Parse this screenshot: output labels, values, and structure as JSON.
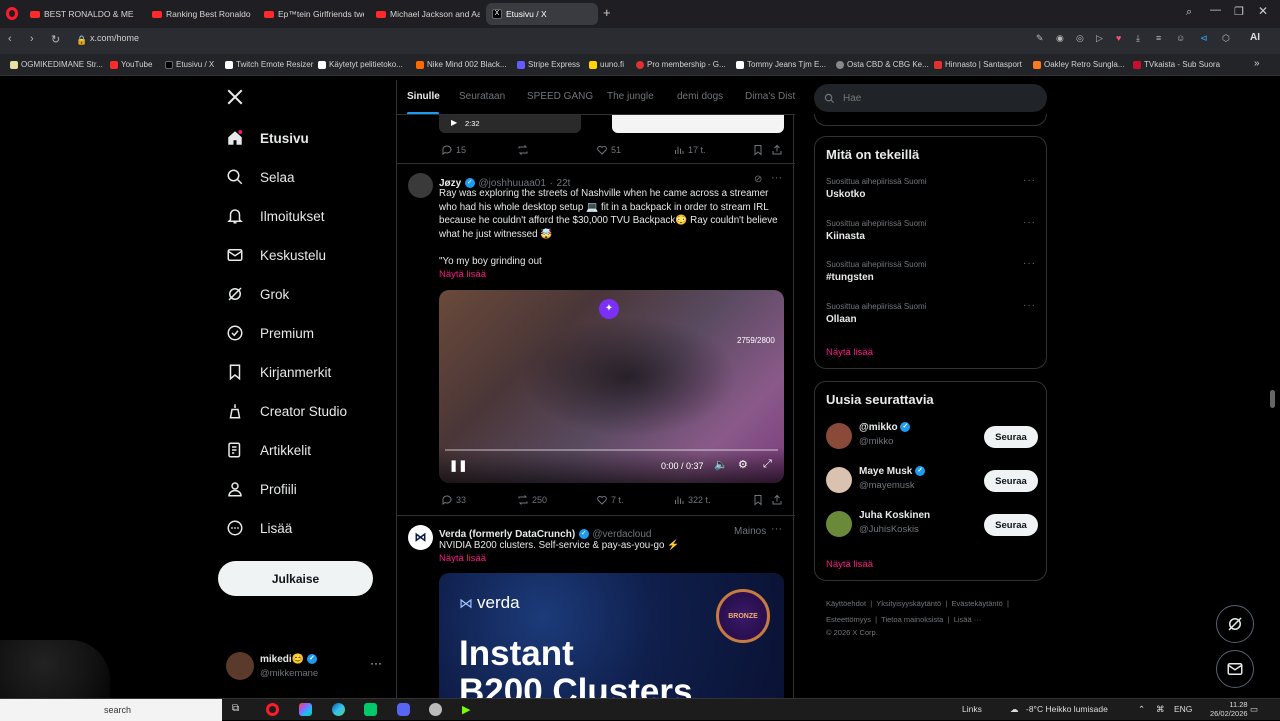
{
  "browser": {
    "tabs": [
      {
        "label": "BEST RONALDO & MESSI",
        "icon": "youtube-icon"
      },
      {
        "label": "Ranking Best Ronaldo & M",
        "icon": "youtube-icon"
      },
      {
        "label": "Ep™tein Girlfriends tweets",
        "icon": "youtube-icon"
      },
      {
        "label": "Michael Jackson and Aaro",
        "icon": "youtube-icon"
      },
      {
        "label": "Etusivu / X",
        "icon": "x-icon",
        "active": true
      }
    ],
    "address": "x.com/home",
    "ai_label": "AI",
    "bookmarks": [
      {
        "label": "OGMIKEDIMANE Str...",
        "color": "#e8e0a0"
      },
      {
        "label": "YouTube",
        "color": "#ff2a2a"
      },
      {
        "label": "Etusivu / X",
        "color": "#000000"
      },
      {
        "label": "Twitch Emote Resizer",
        "color": "#ffffff"
      },
      {
        "label": "Käytetyt pelitietoko...",
        "color": "#ffffff"
      },
      {
        "label": "Nike Mind 002 Black...",
        "color": "#ff6a00"
      },
      {
        "label": "Stripe Express",
        "color": "#635bff"
      },
      {
        "label": "uuno.fi",
        "color": "#ffd400"
      },
      {
        "label": "Pro membership - G...",
        "color": "#e03030"
      },
      {
        "label": "Tommy Jeans Tjm E...",
        "color": "#ffffff"
      },
      {
        "label": "Osta CBD & CBG Ke...",
        "color": "#888888"
      },
      {
        "label": "Hinnasto | Santasport",
        "color": "#e03030"
      },
      {
        "label": "Oakley Retro Sungla...",
        "color": "#ff7a1a"
      },
      {
        "label": "TVkaista - Sub Suora",
        "color": "#c8102e"
      }
    ]
  },
  "nav": {
    "items": [
      {
        "label": "Etusivu",
        "icon": "home-icon",
        "active": true
      },
      {
        "label": "Selaa",
        "icon": "search-icon"
      },
      {
        "label": "Ilmoitukset",
        "icon": "bell-icon"
      },
      {
        "label": "Keskustelu",
        "icon": "mail-icon"
      },
      {
        "label": "Grok",
        "icon": "grok-icon"
      },
      {
        "label": "Premium",
        "icon": "premium-icon"
      },
      {
        "label": "Kirjanmerkit",
        "icon": "bookmark-icon"
      },
      {
        "label": "Creator Studio",
        "icon": "creator-icon"
      },
      {
        "label": "Artikkelit",
        "icon": "article-icon"
      },
      {
        "label": "Profiili",
        "icon": "profile-icon"
      },
      {
        "label": "Lisää",
        "icon": "more-circle-icon"
      }
    ],
    "post_button": "Julkaise",
    "account": {
      "name": "mikedi😊",
      "handle": "@mikkemane"
    }
  },
  "feed": {
    "tabs": [
      "Sinulle",
      "Seurataan",
      "SPEED GANG",
      "The jungle",
      "demi dogs",
      "Dima's Dist"
    ],
    "prev_post": {
      "duration": "2:32",
      "replies": "15",
      "reposts": "",
      "likes": "51",
      "views": "17 t."
    },
    "post": {
      "name": "Jøzy",
      "handle": "@joshhuuaa01",
      "time": "22t",
      "text_1": "Ray was exploring the streets of Nashville when he came across a streamer who had his whole desktop setup 💻 fit in a backpack in order to stream IRL because he couldn't afford the $30,000 TVU Backpack😳 Ray couldn't believe what he just witnessed 🤯",
      "text_2": "\"Yo my boy grinding out",
      "show_more": "Näytä lisää",
      "video": {
        "overlay_count": "2759/2800",
        "time": "0:00 / 0:37"
      },
      "replies": "33",
      "reposts": "250",
      "likes": "7 t.",
      "views": "322 t."
    },
    "ad": {
      "name": "Verda (formerly DataCrunch)",
      "handle": "@verdacloud",
      "label": "Mainos",
      "text": "NVIDIA B200 clusters. Self-service & pay-as-you-go ⚡",
      "show_more": "Näytä lisää",
      "image_brand": "verda",
      "image_headline_1": "Instant",
      "image_headline_2": "B200 Clusters",
      "badge_text": "BRONZE"
    }
  },
  "sidebar": {
    "search_placeholder": "Hae",
    "trends_title": "Mitä on tekeillä",
    "trends": [
      {
        "context": "Suosittua aihepiirissä Suomi",
        "name": "Uskotko"
      },
      {
        "context": "Suosittua aihepiirissä Suomi",
        "name": "Kiinasta"
      },
      {
        "context": "Suosittua aihepiirissä Suomi",
        "name": "#tungsten"
      },
      {
        "context": "Suosittua aihepiirissä Suomi",
        "name": "Ollaan"
      }
    ],
    "trends_more": "Näytä lisää",
    "who_title": "Uusia seurattavia",
    "who": [
      {
        "name": "@mikko",
        "handle": "@mikko",
        "button": "Seuraa",
        "verified": true,
        "avatar_color": "#8a4a3a"
      },
      {
        "name": "Maye Musk",
        "handle": "@mayemusk",
        "button": "Seuraa",
        "verified": true,
        "avatar_color": "#d9c3b0"
      },
      {
        "name": "Juha Koskinen",
        "handle": "@JuhisKoskis",
        "button": "Seuraa",
        "verified": false,
        "avatar_color": "#6a8a3a"
      }
    ],
    "who_more": "Näytä lisää",
    "footer": {
      "line1": [
        "Käyttöehdot",
        "Yksityisyyskäytäntö",
        "Evästekäytäntö"
      ],
      "line2": [
        "Esteettömyys",
        "Tietoa mainoksista",
        "Lisää ···"
      ],
      "copyright": "© 2026 X Corp."
    }
  },
  "taskbar": {
    "search": "search",
    "links": "Links",
    "weather": "-8°C  Heikko lumisade",
    "lang": "ENG",
    "time": "11.28",
    "date": "26/02/2026"
  }
}
